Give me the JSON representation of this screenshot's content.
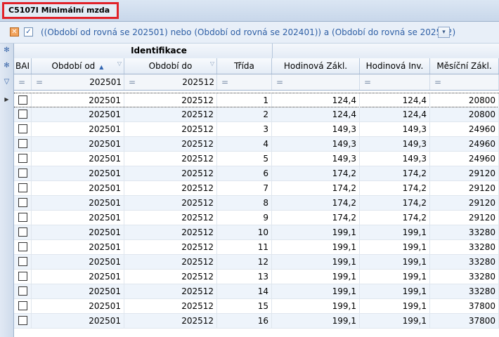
{
  "window": {
    "title": "C5107I Minimální mzda"
  },
  "filter": {
    "text": "((Období od rovná se 202501) nebo (Období od rovná se 202401)) a  (Období do rovná se 202512)",
    "clear_icon": "✕",
    "check_icon": "✓",
    "dropdown_icon": "▾"
  },
  "grid": {
    "group_header": "Identifikace",
    "columns": {
      "bai": "BAI",
      "obdobi_od": "Období od",
      "obdobi_do": "Období do",
      "trida": "Třída",
      "hodinova_zakl": "Hodinová Zákl.",
      "hodinova_inv": "Hodinová Inv.",
      "mesicni_zakl": "Měsíční Zákl."
    },
    "filter_row": {
      "eq_symbol": "=",
      "obdobi_od": "202501",
      "obdobi_do": "202512"
    },
    "rows": [
      {
        "od": "202501",
        "do": "202512",
        "trida": "1",
        "hz": "124,4",
        "hi": "124,4",
        "mz": "20800"
      },
      {
        "od": "202501",
        "do": "202512",
        "trida": "2",
        "hz": "124,4",
        "hi": "124,4",
        "mz": "20800"
      },
      {
        "od": "202501",
        "do": "202512",
        "trida": "3",
        "hz": "149,3",
        "hi": "149,3",
        "mz": "24960"
      },
      {
        "od": "202501",
        "do": "202512",
        "trida": "4",
        "hz": "149,3",
        "hi": "149,3",
        "mz": "24960"
      },
      {
        "od": "202501",
        "do": "202512",
        "trida": "5",
        "hz": "149,3",
        "hi": "149,3",
        "mz": "24960"
      },
      {
        "od": "202501",
        "do": "202512",
        "trida": "6",
        "hz": "174,2",
        "hi": "174,2",
        "mz": "29120"
      },
      {
        "od": "202501",
        "do": "202512",
        "trida": "7",
        "hz": "174,2",
        "hi": "174,2",
        "mz": "29120"
      },
      {
        "od": "202501",
        "do": "202512",
        "trida": "8",
        "hz": "174,2",
        "hi": "174,2",
        "mz": "29120"
      },
      {
        "od": "202501",
        "do": "202512",
        "trida": "9",
        "hz": "174,2",
        "hi": "174,2",
        "mz": "29120"
      },
      {
        "od": "202501",
        "do": "202512",
        "trida": "10",
        "hz": "199,1",
        "hi": "199,1",
        "mz": "33280"
      },
      {
        "od": "202501",
        "do": "202512",
        "trida": "11",
        "hz": "199,1",
        "hi": "199,1",
        "mz": "33280"
      },
      {
        "od": "202501",
        "do": "202512",
        "trida": "12",
        "hz": "199,1",
        "hi": "199,1",
        "mz": "33280"
      },
      {
        "od": "202501",
        "do": "202512",
        "trida": "13",
        "hz": "199,1",
        "hi": "199,1",
        "mz": "33280"
      },
      {
        "od": "202501",
        "do": "202512",
        "trida": "14",
        "hz": "199,1",
        "hi": "199,1",
        "mz": "33280"
      },
      {
        "od": "202501",
        "do": "202512",
        "trida": "15",
        "hz": "199,1",
        "hi": "199,1",
        "mz": "37800"
      },
      {
        "od": "202501",
        "do": "202512",
        "trida": "16",
        "hz": "199,1",
        "hi": "199,1",
        "mz": "37800"
      }
    ]
  },
  "colors": {
    "title_highlight": "#e1222a",
    "filter_text": "#2e5fa5",
    "alt_row": "#eef4fb"
  }
}
